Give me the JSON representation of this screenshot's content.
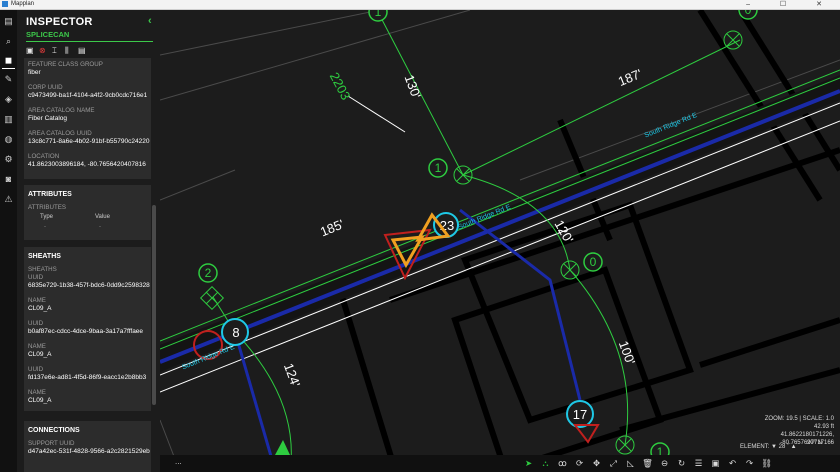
{
  "window": {
    "app_name": "Mapplan",
    "controls": "–  ☐  ✕"
  },
  "rail": {
    "icons": [
      "layers-icon",
      "search-icon",
      "inspector-icon",
      "edit-icon",
      "stack-icon",
      "report-icon",
      "globe-icon",
      "settings-icon",
      "camera-icon",
      "alert-icon"
    ]
  },
  "inspector": {
    "title": "INSPECTOR",
    "collapse": "‹",
    "subtitle": "SPLICECAN",
    "tools": [
      "save-icon",
      "delete-icon",
      "connect-icon",
      "split-icon",
      "document-icon"
    ],
    "details": [
      {
        "key": "FEATURE CLASS GROUP",
        "value": "fiber"
      },
      {
        "key": "CORP UUID",
        "value": "c9473499-ba1f-4104-a4f2-9cb0cdc716e1"
      },
      {
        "key": "AREA CATALOG NAME",
        "value": "Fiber Catalog"
      },
      {
        "key": "AREA CATALOG UUID",
        "value": "13c8c771-8a6e-4b02-91bf-b55790c24220"
      },
      {
        "key": "LOCATION",
        "value": "41.8623003896184, -80.7656420407816"
      }
    ],
    "attributes": {
      "header": "ATTRIBUTES",
      "label": "ATTRIBUTES",
      "col_type": "Type",
      "col_value": "Value",
      "type": "-",
      "value": "-"
    },
    "sheaths": {
      "header": "SHEATHS",
      "label": "SHEATHS",
      "items": [
        {
          "uuid_key": "UUID",
          "uuid": "6835e729-1b38-457f-bdc6-0dd9c2598328",
          "name_key": "NAME",
          "name": "CL09_A"
        },
        {
          "uuid_key": "UUID",
          "uuid": "b0af87ec-cdcc-4dce-9baa-3a17a7fffaee",
          "name_key": "NAME",
          "name": "CL09_A"
        },
        {
          "uuid_key": "UUID",
          "uuid": "fd137e6e-ad81-4f5d-86f9-eacc1e2b8bb3",
          "name_key": "NAME",
          "name": "CL09_A"
        }
      ]
    },
    "connections": {
      "header": "CONNECTIONS",
      "key": "SUPPORT UUID",
      "value": "d47a42ec-531f-4828-9566-a2c2821529eb"
    }
  },
  "map": {
    "labels": {
      "dist_130": "130'",
      "dist_187": "187'",
      "dist_185": "185'",
      "dist_120": "120'",
      "dist_100": "100'",
      "dist_124": "124'",
      "num_2203": "2203",
      "road_1": "South Ridge Rd E",
      "road_2": "South Ridge Rd E",
      "road_3": "South Ridge Rd E"
    },
    "nodes": [
      "1",
      "0",
      "1",
      "2",
      "23",
      "8",
      "0",
      "17",
      "1"
    ],
    "colors": {
      "green": "#2ecc40",
      "blue": "#1a2aa8",
      "cyan": "#1ec8e6",
      "red": "#c0201e",
      "orange": "#f0a020",
      "white": "#ffffff"
    }
  },
  "status": {
    "zoom": "ZOOM: 19.5  |  SCALE: 1.0",
    "distance": "42.93 ft",
    "coords": "41.8622180171226, -80.7657697717166",
    "element": "ELEMENT:  ▼  28 ˚  ▲",
    "compass": "20°  N",
    "dots": "...",
    "tools": [
      "select-icon",
      "network-icon",
      "lasso-icon",
      "rotate-icon",
      "move-icon",
      "resize-icon",
      "measure-icon",
      "delete-icon",
      "minus-icon",
      "refresh-icon",
      "list-icon",
      "image-icon",
      "undo-icon",
      "redo-icon",
      "link-icon"
    ]
  }
}
